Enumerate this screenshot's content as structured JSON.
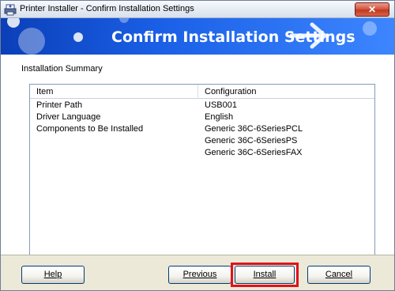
{
  "window": {
    "title": "Printer Installer - Confirm Installation Settings",
    "close_label": "✕",
    "icons": {
      "app": "printer-icon",
      "arrow": "arrow-right-icon"
    }
  },
  "banner": {
    "title": "Confirm Installation Settings"
  },
  "summary": {
    "label": "Installation Summary",
    "columns": {
      "item": "Item",
      "configuration": "Configuration"
    },
    "rows": [
      {
        "item": "Printer Path",
        "config": "USB001"
      },
      {
        "item": "Driver Language",
        "config": "English"
      },
      {
        "item": "Components to Be Installed",
        "config": "Generic 36C-6SeriesPCL"
      },
      {
        "item": "",
        "config": "Generic 36C-6SeriesPS"
      },
      {
        "item": "",
        "config": "Generic 36C-6SeriesFAX"
      }
    ]
  },
  "buttons": {
    "help": "Help",
    "previous": "Previous",
    "install": "Install",
    "cancel": "Cancel"
  },
  "colors": {
    "banner": "#1a5fe6",
    "highlight": "#e0121b",
    "face": "#ece9d8"
  }
}
